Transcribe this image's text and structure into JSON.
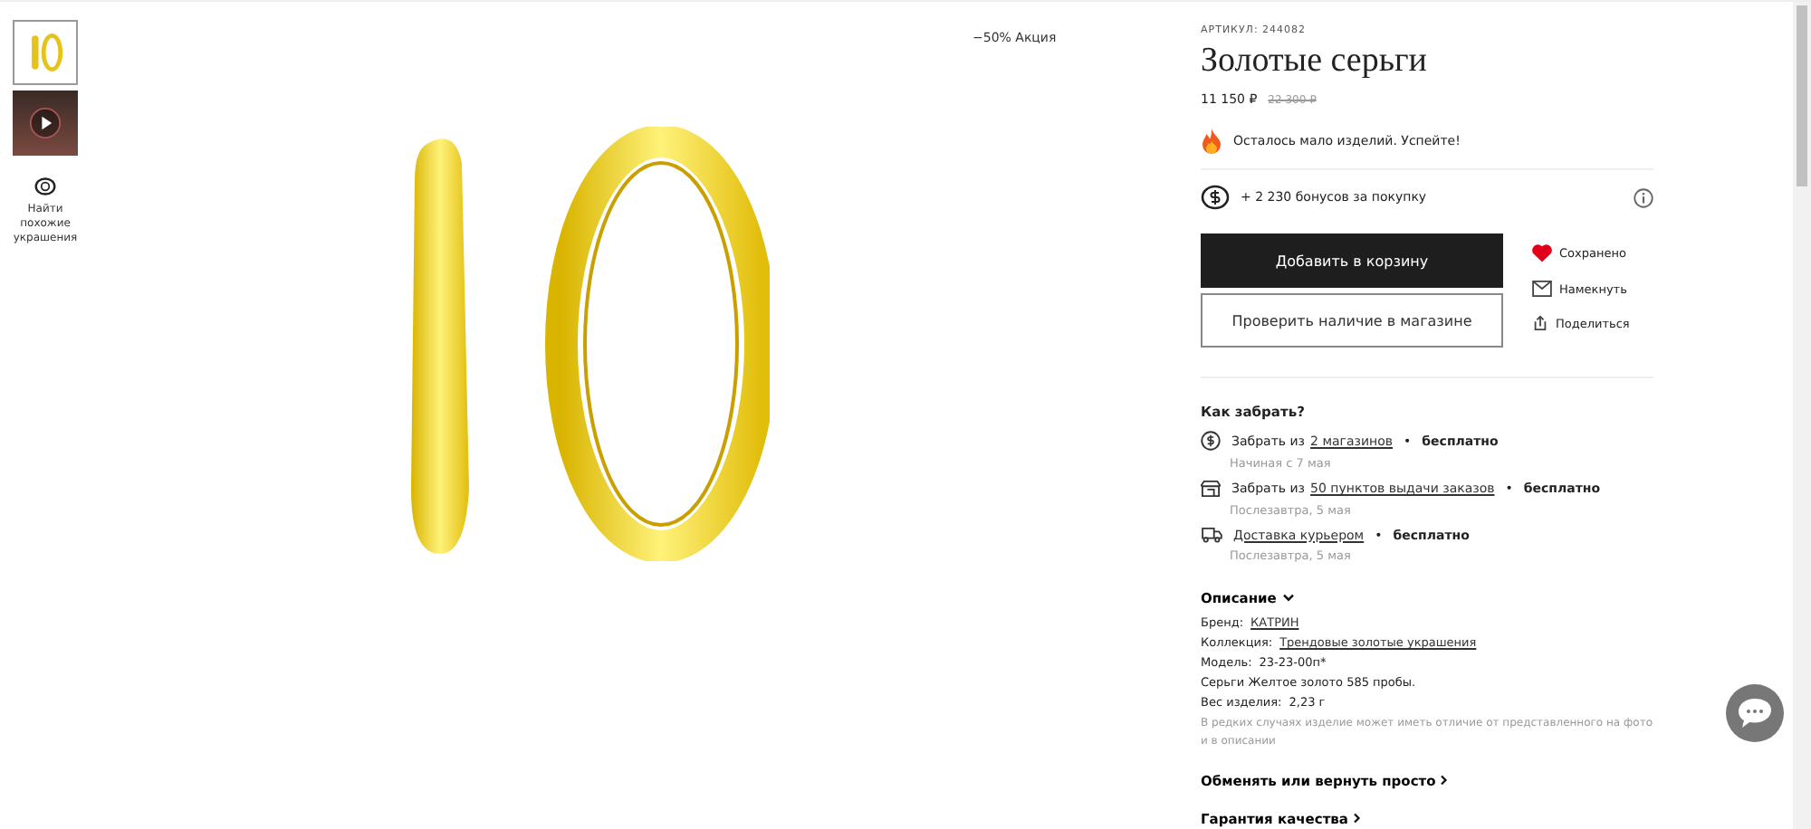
{
  "gallery": {
    "thumbnails": [
      {
        "kind": "image",
        "selected": true
      },
      {
        "kind": "video",
        "selected": false
      }
    ],
    "similar_label": "Найти похожие украшения"
  },
  "badge": "−50% Акция",
  "product": {
    "sku_label": "АРТИКУЛ:",
    "sku": "244082",
    "title": "Золотые серьги",
    "price": "11 150 ₽",
    "old_price": "22 300 ₽",
    "stock_note": "Осталось мало изделий. Успейте!",
    "bonus": "+ 2 230 бонусов за покупку",
    "add_to_cart": "Добавить в корзину",
    "check_store": "Проверить наличие в магазине",
    "actions": [
      {
        "kind": "save",
        "label": "Сохранено",
        "saved": true
      },
      {
        "kind": "hint",
        "label": "Намекнуть"
      },
      {
        "kind": "share",
        "label": "Поделиться"
      }
    ]
  },
  "delivery": {
    "title": "Как забрать?",
    "options": [
      {
        "kind": "store",
        "prefix": "Забрать из",
        "link": "2 магазинов",
        "bullet": "•",
        "price": "бесплатно",
        "date": "Начиная с 7 мая"
      },
      {
        "kind": "pickup",
        "prefix": "Забрать из",
        "link": "50 пунктов выдачи заказов",
        "bullet": "•",
        "price": "бесплатно",
        "date": "Послезавтра, 5 мая"
      },
      {
        "kind": "courier",
        "link": "Доставка курьером",
        "bullet": "•",
        "price": "бесплатно",
        "date": "Послезавтра, 5 мая"
      }
    ]
  },
  "description": {
    "title": "Описание",
    "expanded": true,
    "lines": [
      {
        "label": "Бренд:",
        "value": "КАТРИН",
        "link": true
      },
      {
        "label": "Коллекция:",
        "value": "Трендовые золотые украшения",
        "link": true
      },
      {
        "label": "Модель:",
        "value": "23-23-00п*",
        "link": false
      },
      {
        "value": "Серьги Желтое золото 585 пробы.",
        "link": false
      },
      {
        "label": "Вес изделия:",
        "value": "2,23 г",
        "link": false
      }
    ],
    "note": "В редких случаях изделие может иметь отличие от представленного на фото и в описании"
  },
  "sections": [
    "Обменять или вернуть просто",
    "Гарантия качества"
  ]
}
